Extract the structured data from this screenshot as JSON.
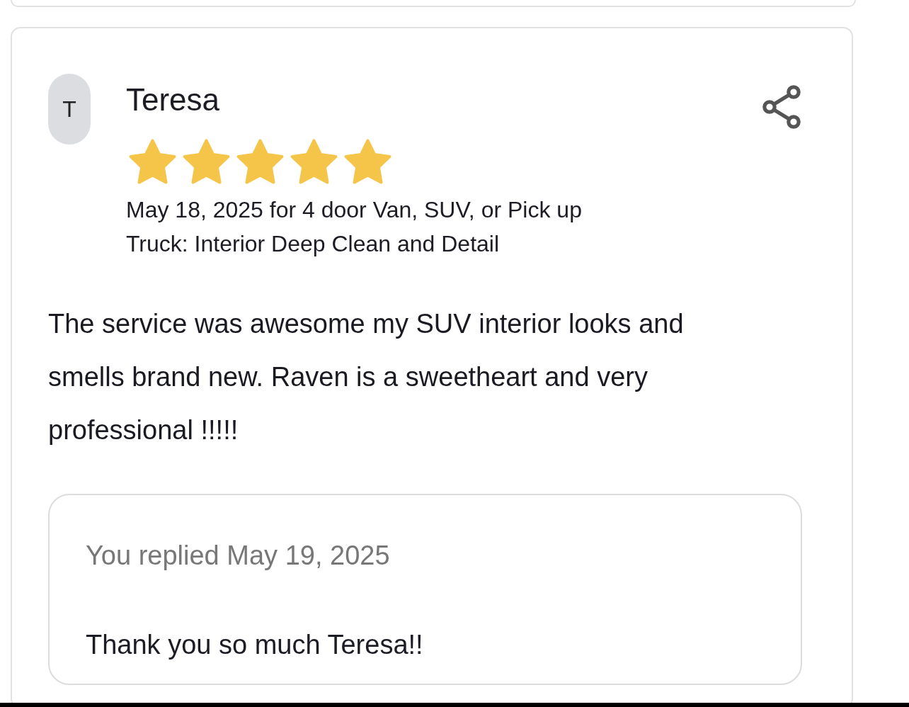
{
  "review": {
    "avatar_initial": "T",
    "reviewer": "Teresa",
    "stars": 5,
    "meta": "May 18, 2025 for 4 door Van, SUV, or Pick up Truck: Interior Deep Clean and Detail",
    "text": "The service was awesome my SUV interior looks and smells brand new. Raven is a sweetheart and very professional !!!!!",
    "reply": {
      "date": "You replied May 19, 2025",
      "text": "Thank you so much Teresa!!"
    }
  }
}
